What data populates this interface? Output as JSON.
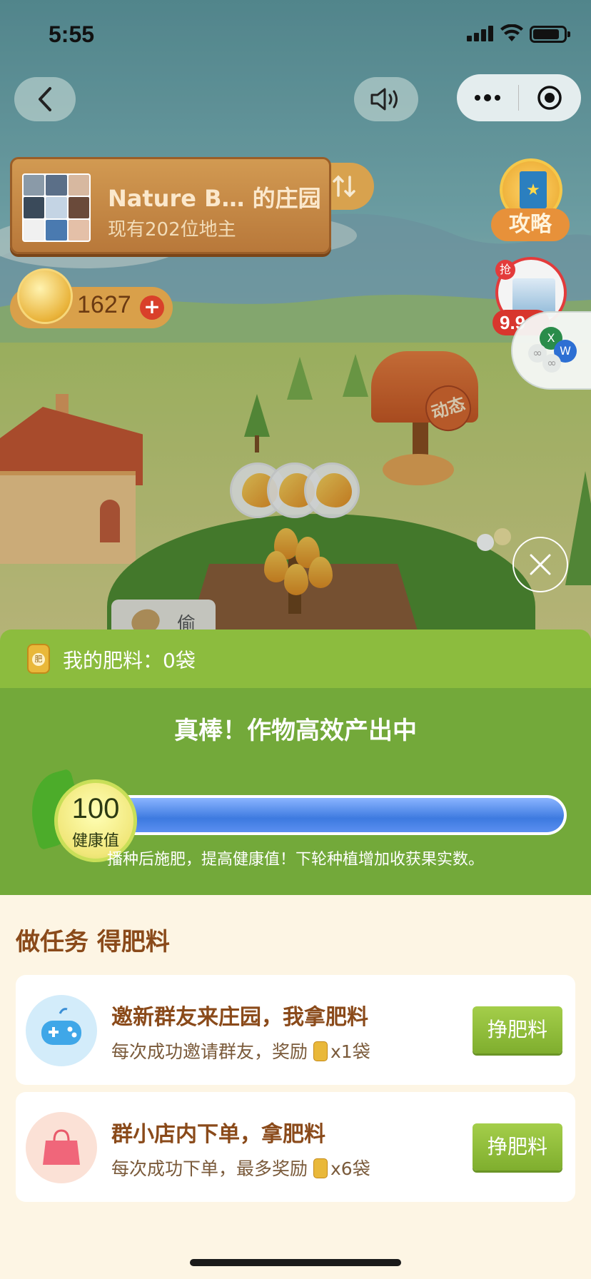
{
  "status_bar": {
    "time": "5:55"
  },
  "farm": {
    "title": "Nature B… 的庄园",
    "owners": "现有202位地主",
    "coins": "1627",
    "guide_label": "攻略",
    "promo_tag": "抢",
    "promo_price": "9.9",
    "mailbox_label": "动态",
    "steal_label": "偷"
  },
  "fertilizer": {
    "label": "我的肥料：0袋"
  },
  "health": {
    "headline": "真棒！作物高效产出中",
    "value": "100",
    "value_label": "健康值",
    "level_fraction": 1.0,
    "note": "播种后施肥，提高健康值！下轮种植增加收获果实数。"
  },
  "tasks": {
    "title": "做任务 得肥料",
    "items": [
      {
        "title": "邀新群友来庄园，我拿肥料",
        "desc": "每次成功邀请群友，奖励",
        "reward": "x1袋",
        "button": "挣肥料",
        "icon": "gamepad-icon"
      },
      {
        "title": "群小店内下单，拿肥料",
        "desc": "每次成功下单，最多奖励",
        "reward": "x6袋",
        "button": "挣肥料",
        "icon": "shopping-bag-icon"
      }
    ]
  },
  "colors": {
    "panel_green": "#73a93a",
    "fert_bar": "#8cbc3e",
    "button_green": "#8dbf3a",
    "progress_blue": "#3d7ae0",
    "brown_text": "#8a4a1a"
  }
}
